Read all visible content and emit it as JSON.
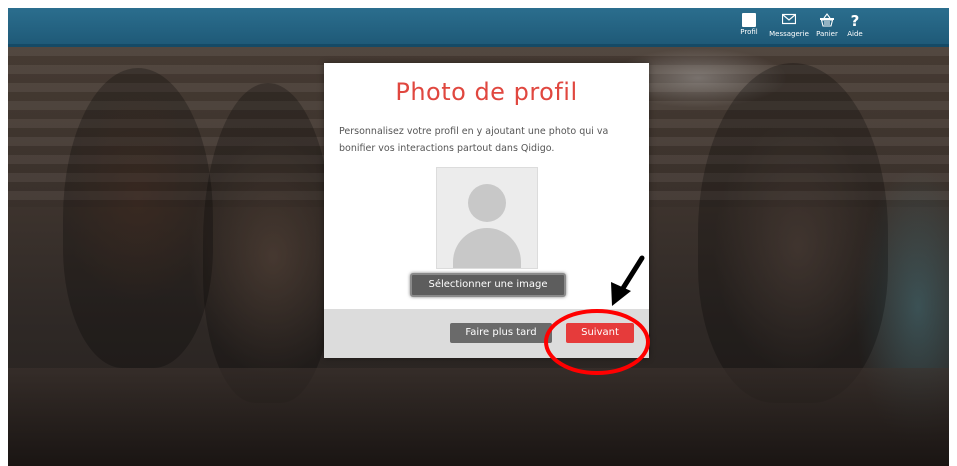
{
  "nav": {
    "items": [
      {
        "label": "Profil",
        "icon": "profile-icon"
      },
      {
        "label": "Messagerie",
        "icon": "envelope-icon"
      },
      {
        "label": "Panier",
        "icon": "basket-icon"
      },
      {
        "label": "Aide",
        "icon": "help-icon"
      }
    ],
    "help_glyph": "?"
  },
  "modal": {
    "title": "Photo de profil",
    "description": "Personnalisez votre profil en y ajoutant une photo qui va bonifier vos interactions partout dans Qidigo.",
    "select_label": "Sélectionner une image",
    "later_label": "Faire plus tard",
    "next_label": "Suivant"
  },
  "colors": {
    "topbar": "#1f5a78",
    "title": "#e0473f",
    "next_button": "#e63b3b",
    "later_button": "#6a6a6a",
    "annotation": "#ff0000"
  }
}
